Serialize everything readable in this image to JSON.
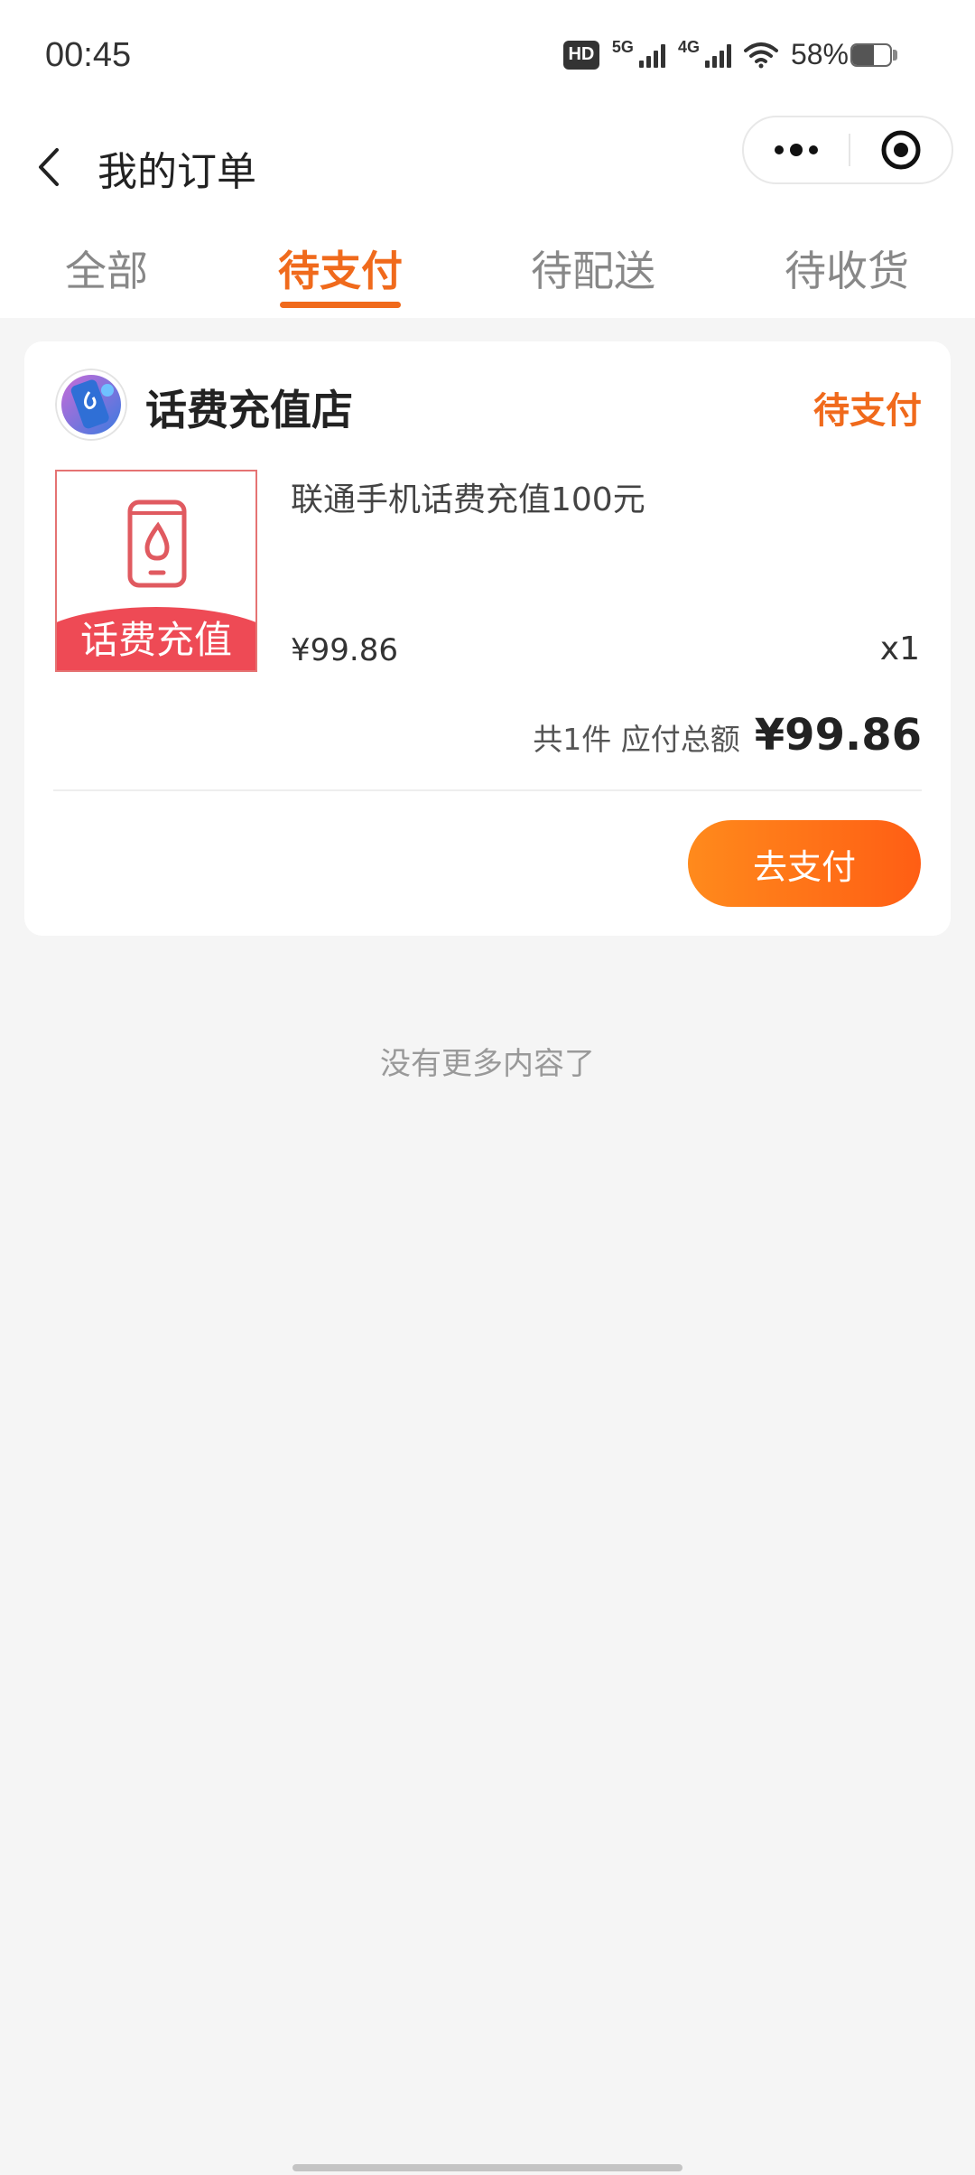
{
  "status_bar": {
    "time": "00:45",
    "hd_label": "HD",
    "network_5g": "5G",
    "network_4g": "4G",
    "battery_percent": "58%",
    "battery_level": 0.58
  },
  "nav": {
    "title": "我的订单",
    "back_icon": "chevron-left-icon",
    "more_icon": "more-dots-icon",
    "close_icon": "target-circle-icon"
  },
  "tabs": [
    {
      "label": "全部",
      "active": false
    },
    {
      "label": "待支付",
      "active": true
    },
    {
      "label": "待配送",
      "active": false
    },
    {
      "label": "待收货",
      "active": false
    }
  ],
  "order": {
    "store_name": "话费充值店",
    "store_logo_icon": "recharge-logo-icon",
    "status": "待支付",
    "product": {
      "name": "联通手机话费充值100元",
      "thumb_label": "话费充值",
      "thumb_icon": "phone-drop-icon",
      "price": "¥99.86",
      "quantity": "x1"
    },
    "total_label": "共1件 应付总额",
    "total_amount": "¥99.86",
    "pay_button_label": "去支付"
  },
  "footer_text": "没有更多内容了",
  "colors": {
    "accent": "#f06a1c",
    "background": "#f5f5f5",
    "button_gradient_start": "#ff8a1c",
    "button_gradient_end": "#ff5e14",
    "thumb_band": "#ee4a55"
  }
}
